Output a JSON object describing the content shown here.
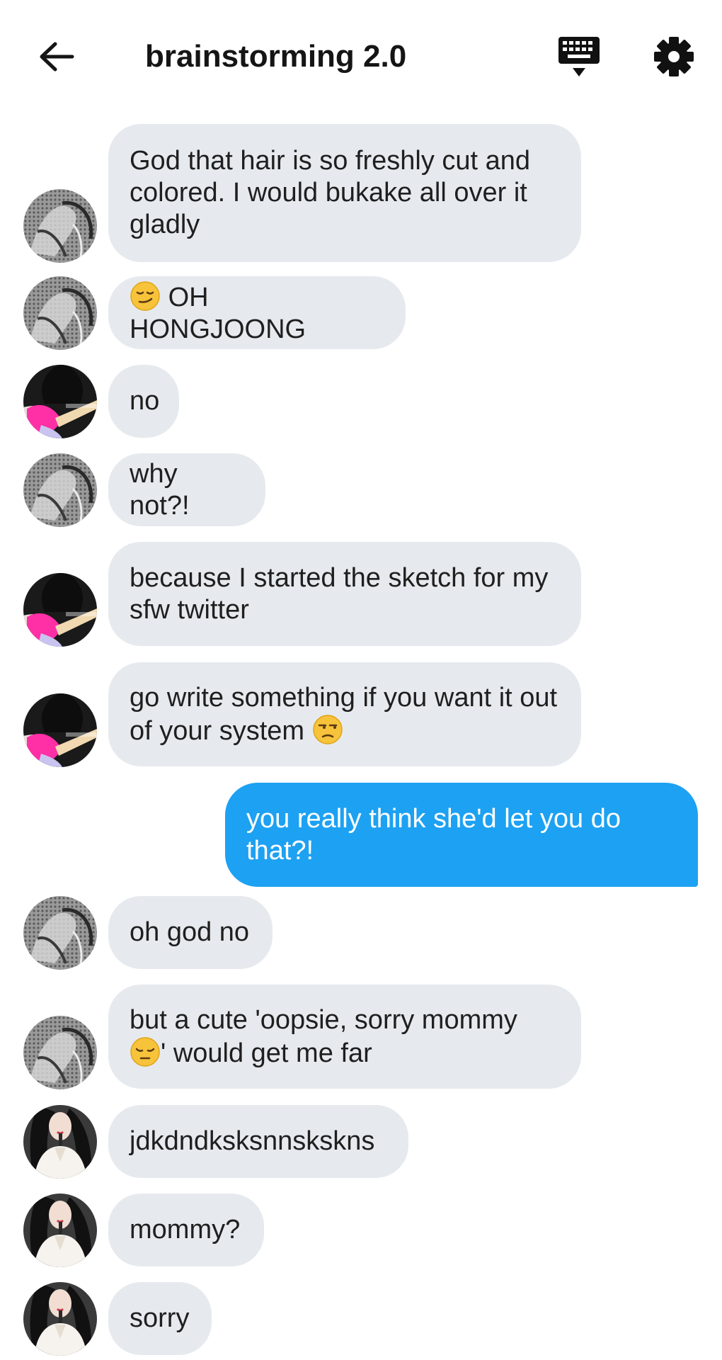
{
  "header": {
    "title": "brainstorming 2.0",
    "back_icon": "arrow-left-icon",
    "keyboard_icon": "keyboard-icon",
    "settings_icon": "gear-icon"
  },
  "colors": {
    "bubble_other": "#e6eaee",
    "bubble_mine": "#1da1f2",
    "text_dark": "#1f1f1f"
  },
  "messages": [
    {
      "sender": "grey-photo",
      "text": "God that hair is so freshly cut and colored. I would bukake all over it gladly"
    },
    {
      "sender": "grey-photo",
      "emoji_before": "smirking-face-icon",
      "text": "OH HONGJOONG"
    },
    {
      "sender": "guitar-photo",
      "text": "no"
    },
    {
      "sender": "grey-photo",
      "text": "why not?!"
    },
    {
      "sender": "guitar-photo",
      "text": "because I started the sketch for my sfw twitter"
    },
    {
      "sender": "guitar-photo",
      "text": "go write something if you want it out of your system",
      "emoji_after": "unamused-face-icon"
    },
    {
      "sender": "me",
      "text": "you really think she'd let you do that?!"
    },
    {
      "sender": "grey-photo",
      "text": "oh god no"
    },
    {
      "sender": "grey-photo",
      "text_before_emoji": "but a cute 'oopsie, sorry mommy",
      "emoji": "pensive-face-icon",
      "text_after_emoji": "' would get me far"
    },
    {
      "sender": "white-outfit-photo",
      "text": "jdkdndksksnnskskns"
    },
    {
      "sender": "white-outfit-photo",
      "text": "mommy?"
    },
    {
      "sender": "white-outfit-photo",
      "text": "sorry"
    }
  ]
}
